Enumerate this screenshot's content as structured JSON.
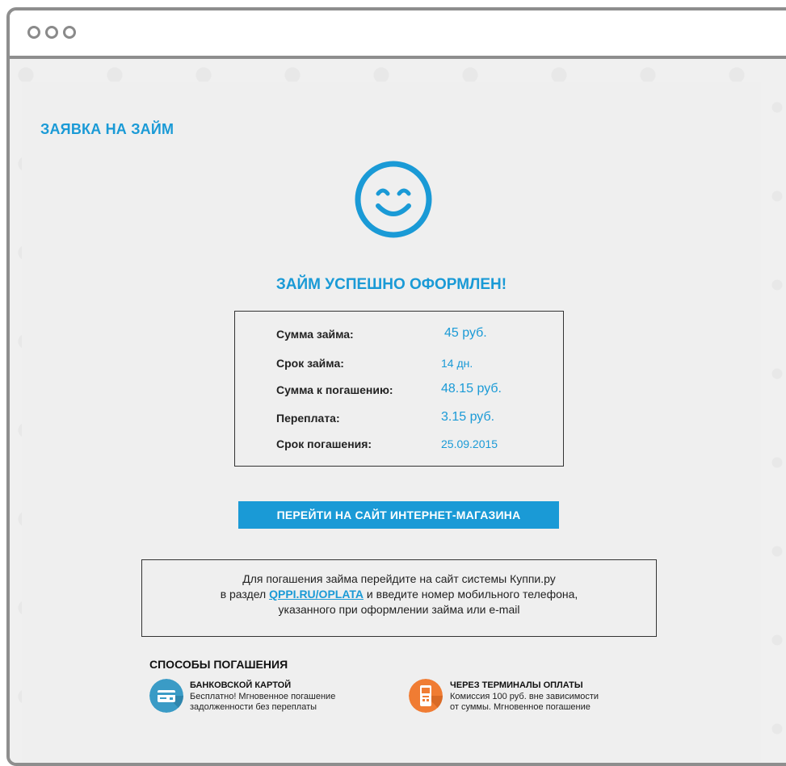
{
  "page": {
    "title": "ЗАЯВКА НА ЗАЙМ",
    "success_message": "ЗАЙМ УСПЕШНО ОФОРМЛЕН!",
    "smiley_icon": "smiley-face-icon"
  },
  "summary": {
    "rows": [
      {
        "label": "Сумма займа:",
        "value": "45 руб."
      },
      {
        "label": "Срок займа:",
        "value": "14 дн."
      },
      {
        "label": "Сумма к погашению:",
        "value": "48.15 руб."
      },
      {
        "label": "Переплата:",
        "value": "3.15 руб."
      },
      {
        "label": "Срок погашения:",
        "value": "25.09.2015"
      }
    ]
  },
  "cta": {
    "label": "ПЕРЕЙТИ НА САЙТ ИНТЕРНЕТ-МАГАЗИНА"
  },
  "info": {
    "line1": "Для погашения займа перейдите на сайт системы Куппи.ру",
    "line2_before": "в раздел ",
    "link_text": "QPPI.RU/OPLATA",
    "line2_after": " и введите номер мобильного телефона,",
    "line3": "указанного при оформлении займа или e-mail"
  },
  "methods": {
    "title": "СПОСОБЫ ПОГАШЕНИЯ",
    "items": [
      {
        "icon": "bank-card-icon",
        "title": "БАНКОВСКОЙ КАРТОЙ",
        "desc_line1": "Бесплатно! Мгновенное погашение",
        "desc_line2": "задолженности без переплаты"
      },
      {
        "icon": "payment-terminal-icon",
        "title": "ЧЕРЕЗ ТЕРМИНАЛЫ ОПЛАТЫ",
        "desc_line1": "Комиссия 100 руб. вне зависимости",
        "desc_line2": "от суммы. Мгновенное погашение"
      }
    ]
  },
  "colors": {
    "accent": "#1a9ad6",
    "card_icon_bg": "#3a9bc6",
    "terminal_icon_bg": "#f07c33",
    "frame": "#8e8e8e",
    "background": "#f0f0f0"
  }
}
